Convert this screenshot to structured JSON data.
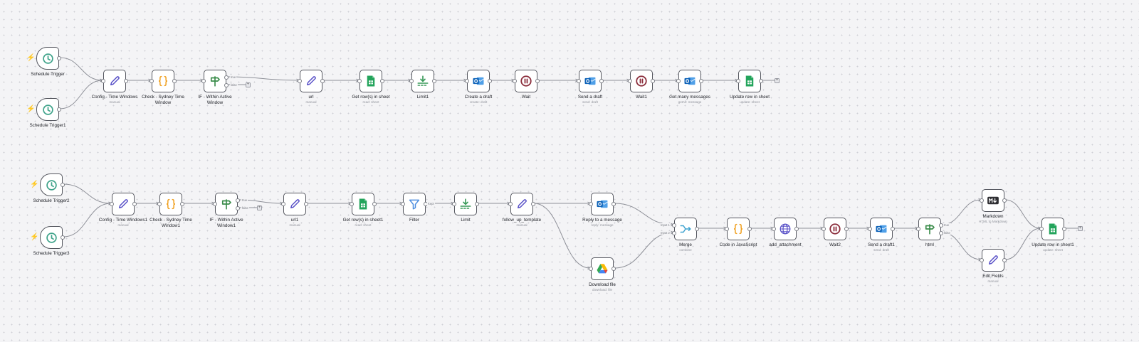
{
  "workflow": {
    "nodes": [
      {
        "id": "st",
        "label": "Schedule Trigger",
        "sub": "",
        "icon": "clock-icon",
        "kind": "trigger"
      },
      {
        "id": "st1",
        "label": "Schedule Trigger1",
        "sub": "",
        "icon": "clock-icon",
        "kind": "trigger"
      },
      {
        "id": "cfg",
        "label": "Config - Time Windows",
        "sub": "manual",
        "icon": "pencil-icon"
      },
      {
        "id": "chk",
        "label": "Check - Sydney Time Window",
        "sub": "",
        "icon": "code-icon"
      },
      {
        "id": "if",
        "label": "IF - Within Active Window",
        "sub": "",
        "icon": "signpost-icon"
      },
      {
        "id": "url",
        "label": "url",
        "sub": "manual",
        "icon": "pencil-icon"
      },
      {
        "id": "grs",
        "label": "Get row(s) in sheet",
        "sub": "read: sheet",
        "icon": "sheets-icon"
      },
      {
        "id": "lim1",
        "label": "Limit1",
        "sub": "",
        "icon": "limit-icon"
      },
      {
        "id": "cd",
        "label": "Create a draft",
        "sub": "create: draft",
        "icon": "outlook-icon"
      },
      {
        "id": "wait",
        "label": "Wait",
        "sub": "",
        "icon": "pause-icon"
      },
      {
        "id": "sd",
        "label": "Send a draft",
        "sub": "send: draft",
        "icon": "outlook-icon"
      },
      {
        "id": "wait1",
        "label": "Wait1",
        "sub": "",
        "icon": "pause-icon"
      },
      {
        "id": "gmm",
        "label": "Get many messages",
        "sub": "getAll: message",
        "icon": "outlook-icon"
      },
      {
        "id": "urs",
        "label": "Update row in sheet",
        "sub": "update: sheet",
        "icon": "sheets-icon"
      },
      {
        "id": "st2",
        "label": "Schedule Trigger2",
        "sub": "",
        "icon": "clock-icon",
        "kind": "trigger"
      },
      {
        "id": "st3",
        "label": "Schedule Trigger3",
        "sub": "",
        "icon": "clock-icon",
        "kind": "trigger"
      },
      {
        "id": "cfg1",
        "label": "Config - Time Windows1",
        "sub": "manual",
        "icon": "pencil-icon"
      },
      {
        "id": "chk1",
        "label": "Check - Sydney Time Window1",
        "sub": "",
        "icon": "code-icon"
      },
      {
        "id": "if1",
        "label": "IF - Within Active Window1",
        "sub": "",
        "icon": "signpost-icon"
      },
      {
        "id": "url1",
        "label": "url1",
        "sub": "manual",
        "icon": "pencil-icon"
      },
      {
        "id": "grs1",
        "label": "Get row(s) in sheet1",
        "sub": "read: sheet",
        "icon": "sheets-icon"
      },
      {
        "id": "flt",
        "label": "Filter",
        "sub": "",
        "icon": "filter-icon"
      },
      {
        "id": "lim",
        "label": "Limit",
        "sub": "",
        "icon": "limit-icon"
      },
      {
        "id": "fut",
        "label": "follow_up_template",
        "sub": "manual",
        "icon": "pencil-icon"
      },
      {
        "id": "rtm",
        "label": "Reply to a message",
        "sub": "reply: message",
        "icon": "outlook-icon"
      },
      {
        "id": "dlf",
        "label": "Download file",
        "sub": "download: file",
        "icon": "drive-icon"
      },
      {
        "id": "mrg",
        "label": "Merge",
        "sub": "combine",
        "icon": "merge-icon"
      },
      {
        "id": "cjs",
        "label": "Code in JavaScript",
        "sub": "",
        "icon": "code-icon"
      },
      {
        "id": "att",
        "label": "add_attachment",
        "sub": "",
        "icon": "globe-icon"
      },
      {
        "id": "wait2",
        "label": "Wait2",
        "sub": "",
        "icon": "pause-icon"
      },
      {
        "id": "sd1",
        "label": "Send a draft1",
        "sub": "send: draft",
        "icon": "outlook-icon"
      },
      {
        "id": "html",
        "label": "html",
        "sub": "",
        "icon": "signpost-icon"
      },
      {
        "id": "md",
        "label": "Markdown",
        "sub": "HTML to Markdown",
        "icon": "markdown-icon"
      },
      {
        "id": "ef",
        "label": "Edit Fields",
        "sub": "manual",
        "icon": "pencil-icon"
      },
      {
        "id": "urs1",
        "label": "Update row in sheet1",
        "sub": "update: sheet",
        "icon": "sheets-icon"
      }
    ],
    "edge_labels": {
      "if_true": "true",
      "if_false": "false",
      "if1_true": "true",
      "if1_false": "false",
      "flt_kept": "Kept",
      "mrg_in1": "Input 1",
      "mrg_in2": "Input 2",
      "html_true": "true",
      "html_false": "false"
    }
  }
}
